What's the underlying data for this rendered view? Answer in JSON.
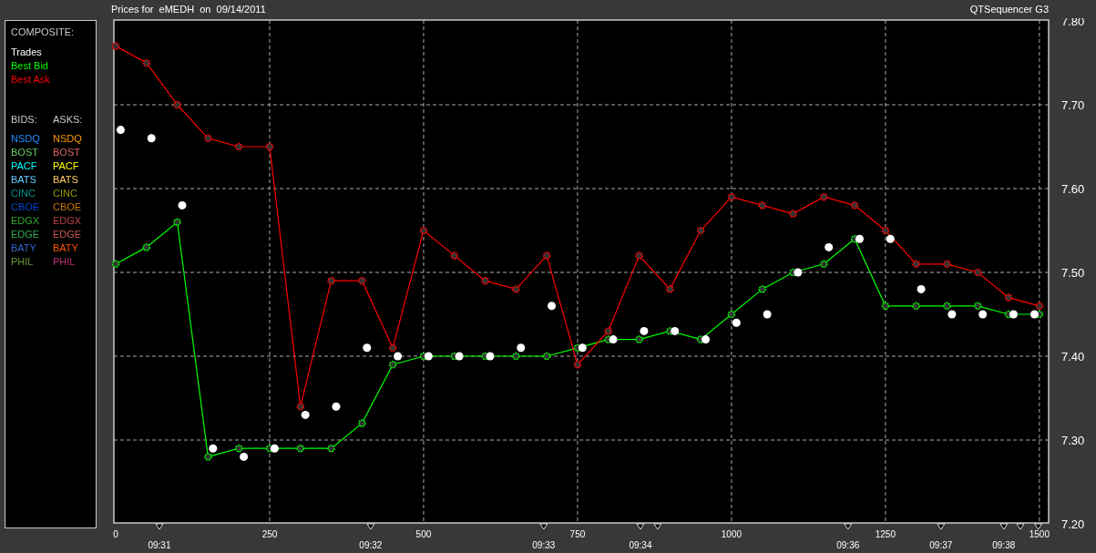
{
  "header": {
    "title": "Prices for  eMEDH  on  09/14/2011",
    "app_name": "QTSequencer G3"
  },
  "legend": {
    "heading": "COMPOSITE:",
    "bids_heading": "BIDS:",
    "asks_heading": "ASKS:",
    "bids": [
      {
        "label": "NSDQ",
        "color": "#1e90ff"
      },
      {
        "label": "BOST",
        "color": "#66cc66"
      },
      {
        "label": "PACF",
        "color": "#00ffff"
      },
      {
        "label": "BATS",
        "color": "#66ccff"
      },
      {
        "label": "CINC",
        "color": "#009999"
      },
      {
        "label": "CBOE",
        "color": "#0044cc"
      },
      {
        "label": "EDGX",
        "color": "#33aa33"
      },
      {
        "label": "EDGE",
        "color": "#33aa55"
      },
      {
        "label": "BATY",
        "color": "#3366cc"
      },
      {
        "label": "PHIL",
        "color": "#669933"
      }
    ],
    "asks": [
      {
        "label": "NSDQ",
        "color": "#ff9900"
      },
      {
        "label": "BOST",
        "color": "#dd6666"
      },
      {
        "label": "PACF",
        "color": "#ffff00"
      },
      {
        "label": "BATS",
        "color": "#ffcc66"
      },
      {
        "label": "CINC",
        "color": "#999900"
      },
      {
        "label": "CBOE",
        "color": "#cc7700"
      },
      {
        "label": "EDGX",
        "color": "#bb4444"
      },
      {
        "label": "EDGE",
        "color": "#cc5555"
      },
      {
        "label": "BATY",
        "color": "#ff5500"
      },
      {
        "label": "PHIL",
        "color": "#bb3377"
      }
    ]
  },
  "chart": {
    "chart_data": {
      "type": "line",
      "x": [
        0,
        50,
        100,
        150,
        200,
        250,
        300,
        350,
        400,
        450,
        500,
        550,
        600,
        650,
        700,
        750,
        800,
        850,
        900,
        950,
        1000,
        1050,
        1100,
        1150,
        1200,
        1250,
        1300,
        1350,
        1400,
        1450,
        1500
      ],
      "series": [
        {
          "name": "Best Bid",
          "color": "#00ff00",
          "marker": "circle",
          "values": [
            7.51,
            7.53,
            7.56,
            7.28,
            7.29,
            7.29,
            7.29,
            7.29,
            7.32,
            7.39,
            7.4,
            7.4,
            7.4,
            7.4,
            7.4,
            7.41,
            7.42,
            7.42,
            7.43,
            7.42,
            7.45,
            7.48,
            7.5,
            7.51,
            7.54,
            7.46,
            7.46,
            7.46,
            7.46,
            7.45,
            7.45
          ]
        },
        {
          "name": "Best Ask",
          "color": "#ff0000",
          "marker": "circle",
          "values": [
            7.77,
            7.75,
            7.7,
            7.66,
            7.65,
            7.65,
            7.34,
            7.49,
            7.49,
            7.41,
            7.55,
            7.52,
            7.49,
            7.48,
            7.52,
            7.39,
            7.43,
            7.52,
            7.48,
            7.55,
            7.59,
            7.58,
            7.57,
            7.59,
            7.58,
            7.55,
            7.51,
            7.51,
            7.5,
            7.47,
            7.46
          ]
        }
      ],
      "grid": true,
      "xlim": [
        0,
        1515
      ],
      "ylim": [
        7.2,
        7.8
      ],
      "xticks": [
        0,
        250,
        500,
        750,
        1000,
        1250,
        1500
      ],
      "yticks": [
        {
          "value": 7.8,
          "label": "7.80"
        },
        {
          "value": 7.7,
          "label": "7.70"
        },
        {
          "value": 7.6,
          "label": "7.60"
        },
        {
          "value": 7.5,
          "label": "7.50"
        },
        {
          "value": 7.4,
          "label": "7.40"
        },
        {
          "value": 7.3,
          "label": "7.30"
        },
        {
          "value": 7.2,
          "label": "7.20"
        }
      ]
    },
    "trades": {
      "chart_data": {
        "type": "scatter",
        "x": [
          8,
          58,
          108,
          158,
          208,
          258,
          308,
          358,
          408,
          458,
          508,
          558,
          608,
          658,
          708,
          758,
          808,
          858,
          908,
          958,
          1008,
          1058,
          1108,
          1158,
          1208,
          1258,
          1308,
          1358,
          1408,
          1458,
          1492
        ],
        "series": [
          {
            "name": "Trades",
            "color": "#ffffff",
            "marker": "circle",
            "values": [
              7.67,
              7.66,
              7.58,
              7.29,
              7.28,
              7.29,
              7.33,
              7.34,
              7.41,
              7.4,
              7.4,
              7.4,
              7.4,
              7.41,
              7.46,
              7.41,
              7.42,
              7.43,
              7.43,
              7.42,
              7.44,
              7.45,
              7.5,
              7.53,
              7.54,
              7.54,
              7.48,
              7.45,
              7.45,
              7.45,
              7.45
            ]
          }
        ],
        "xlim": [
          0,
          1515
        ],
        "ylim": [
          7.2,
          7.8
        ]
      }
    },
    "time_labels": [
      "09:31",
      "09:32",
      "09:33",
      "09:34",
      "09:36",
      "09:37",
      "09:38"
    ]
  }
}
